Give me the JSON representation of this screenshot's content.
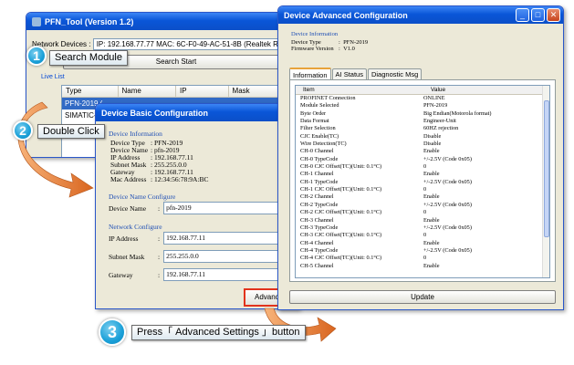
{
  "main_window": {
    "title": "PFN_Tool (Version 1.2)",
    "network_devices_label": "Network Devices :",
    "network_device_value": "IP: 192.168.77.77  MAC: 6C-F0-49-AC-51-8B (Realtek RTL8168",
    "search_start_label": "Search Start",
    "live_list_label": "Live List",
    "list_columns": [
      "Type",
      "Name",
      "IP",
      "Mask"
    ],
    "list_rows": [
      {
        "type": "PFN-2019 (",
        "name": "",
        "ip": "",
        "mask": ""
      },
      {
        "type": "SIMATIC-",
        "name": "",
        "ip": "",
        "mask": ""
      }
    ]
  },
  "basic_window": {
    "title": "Device Basic Configuration",
    "info_section": "Device Information",
    "info": [
      {
        "key": "Device Type",
        "value": "PFN-2019"
      },
      {
        "key": "Device Name",
        "value": "pfn-2019"
      },
      {
        "key": "IP Address",
        "value": "192.168.77.11"
      },
      {
        "key": "Subnet Mask",
        "value": "255.255.0.0"
      },
      {
        "key": "Gateway",
        "value": "192.168.77.11"
      },
      {
        "key": "Mac Address",
        "value": "12:34:56:78:9A:BC"
      }
    ],
    "name_section": "Device Name Configure",
    "device_name_label": "Device Name",
    "device_name_value": "pfn-2019",
    "network_section": "Network Configure",
    "ip_label": "IP Address",
    "ip_value": "192.168.77.11",
    "mask_label": "Subnet Mask",
    "mask_value": "255.255.0.0",
    "gateway_label": "Gateway",
    "gateway_value": "192.168.77.11",
    "advanced_button": "Advance"
  },
  "advanced_window": {
    "title": "Device Advanced Configuration",
    "info_section": "Device Information",
    "device_type_label": "Device Type",
    "device_type_value": "PFN-2019",
    "firmware_label": "Firmware Version",
    "firmware_value": "V1.0",
    "tabs": [
      "Information",
      "AI Status",
      "Diagnostic Msg"
    ],
    "table_headers": [
      "Item",
      "Value"
    ],
    "rows": [
      [
        "PROFINET Connection",
        "ONLINE"
      ],
      [
        "Module Selected",
        "PFN-2019"
      ],
      [
        "Byte Order",
        "Big Endian(Motorola format)"
      ],
      [
        "Data Format",
        "Engineer-Unit"
      ],
      [
        "Filter Selection",
        "60HZ rejection"
      ],
      [
        "CJC Enable(TC)",
        "Disable"
      ],
      [
        "Wire Detection(TC)",
        "Disable"
      ],
      [
        "CH-0 Channel",
        "Enable"
      ],
      [
        "CH-0 TypeCode",
        "+/-2.5V (Code 0x05)"
      ],
      [
        "CH-0 CJC Offset(TC)(Unit: 0.1°C)",
        "0"
      ],
      [
        "CH-1 Channel",
        "Enable"
      ],
      [
        "CH-1 TypeCode",
        "+/-2.5V (Code 0x05)"
      ],
      [
        "CH-1 CJC Offset(TC)(Unit: 0.1°C)",
        "0"
      ],
      [
        "CH-2 Channel",
        "Enable"
      ],
      [
        "CH-2 TypeCode",
        "+/-2.5V (Code 0x05)"
      ],
      [
        "CH-2 CJC Offset(TC)(Unit: 0.1°C)",
        "0"
      ],
      [
        "CH-3 Channel",
        "Enable"
      ],
      [
        "CH-3 TypeCode",
        "+/-2.5V (Code 0x05)"
      ],
      [
        "CH-3 CJC Offset(TC)(Unit: 0.1°C)",
        "0"
      ],
      [
        "CH-4 Channel",
        "Enable"
      ],
      [
        "CH-4 TypeCode",
        "+/-2.5V (Code 0x05)"
      ],
      [
        "CH-4 CJC Offset(TC)(Unit: 0.1°C)",
        "0"
      ],
      [
        "CH-5 Channel",
        "Enable"
      ]
    ],
    "update_button": "Update"
  },
  "callouts": [
    {
      "number": "1",
      "label": "Search Module"
    },
    {
      "number": "2",
      "label": "Double Click"
    },
    {
      "number": "3",
      "label": "Press「 Advanced Settings 」button"
    }
  ],
  "colors": {
    "titlebar": "#0a56d8",
    "badge": "#1aa0d8",
    "arrow": "#e07a2a",
    "highlight": "#e2331c",
    "section_text": "#1f4fb5"
  }
}
